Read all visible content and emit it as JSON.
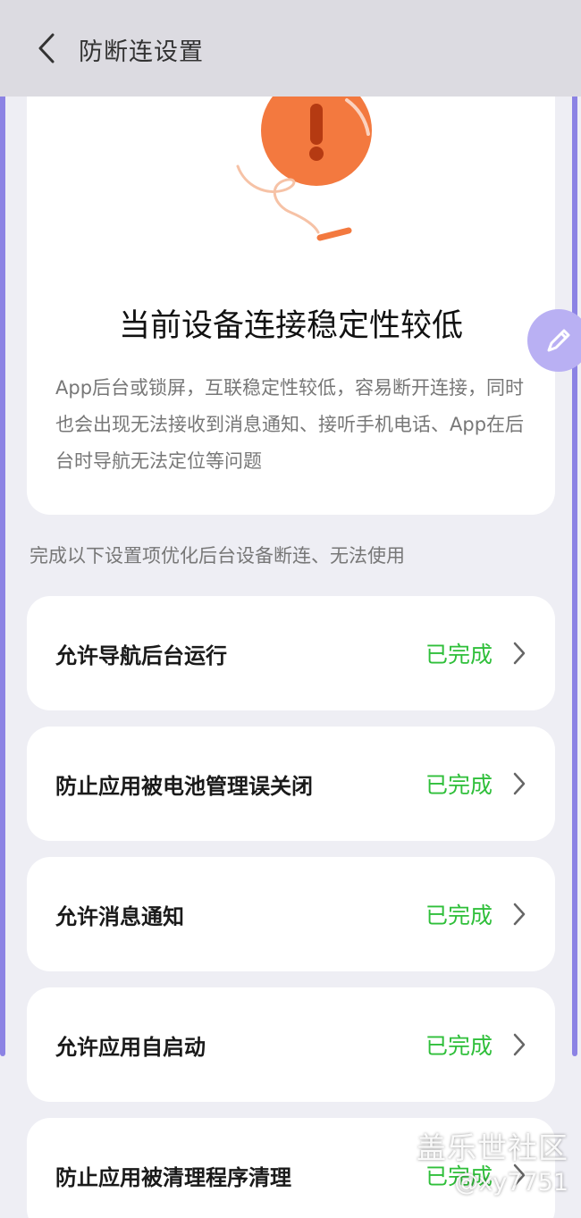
{
  "header": {
    "title": "防断连设置",
    "back_icon": "chevron-left-icon"
  },
  "warning": {
    "title": "当前设备连接稳定性较低",
    "description": "App后台或锁屏，互联稳定性较低，容易断开连接，同时也会出现无法接收到消息通知、接听手机电话、App在后台时导航无法定位等问题",
    "illustration_icon": "warning-exclamation-icon",
    "accent_color": "#f3793f"
  },
  "hint": "完成以下设置项优化后台设备断连、无法使用",
  "items": [
    {
      "label": "允许导航后台运行",
      "status": "已完成"
    },
    {
      "label": "防止应用被电池管理误关闭",
      "status": "已完成"
    },
    {
      "label": "允许消息通知",
      "status": "已完成"
    },
    {
      "label": "允许应用自启动",
      "status": "已完成"
    },
    {
      "label": "防止应用被清理程序清理",
      "status": "已完成"
    }
  ],
  "status_color": "#2fbf3a",
  "float_button_icon": "pen-icon",
  "watermark": {
    "line1": "盖乐世社区",
    "line2": "@xy7751"
  }
}
